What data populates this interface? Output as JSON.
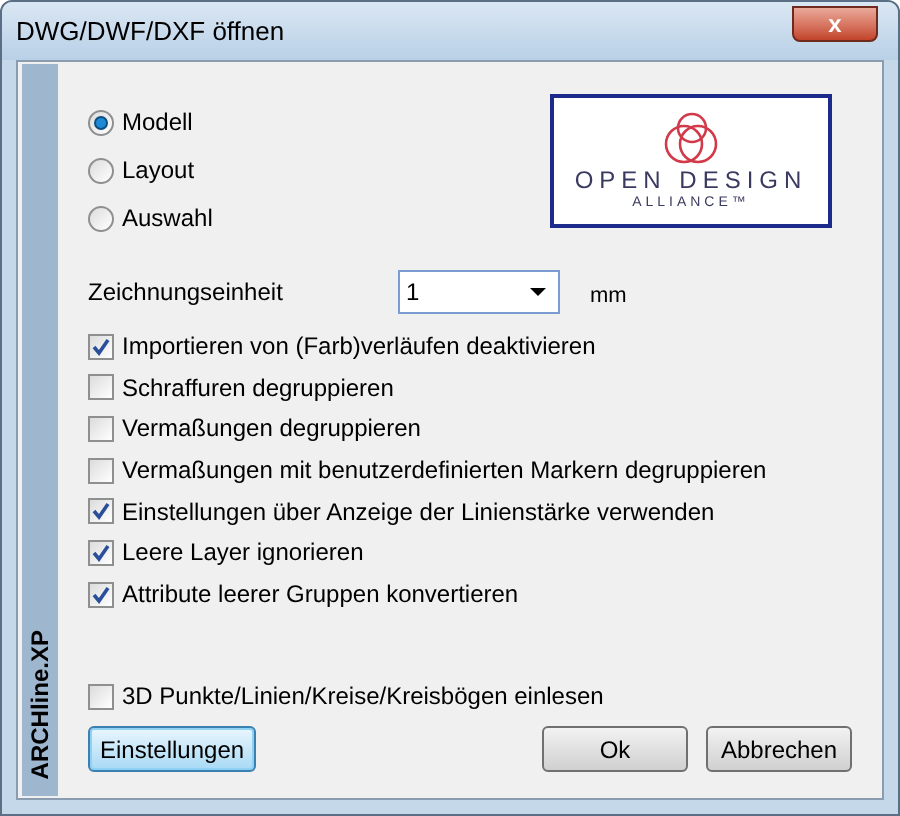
{
  "window": {
    "title": "DWG/DWF/DXF öffnen",
    "close": "x"
  },
  "side_label": "ARCHline.XP",
  "radios": [
    {
      "label": "Modell",
      "selected": true
    },
    {
      "label": "Layout",
      "selected": false
    },
    {
      "label": "Auswahl",
      "selected": false
    }
  ],
  "logo": {
    "line1": "OPEN DESIGN",
    "line2": "ALLIANCE™"
  },
  "unit": {
    "label": "Zeichnungseinheit",
    "value": "1",
    "suffix": "mm"
  },
  "options": [
    {
      "label": "Importieren von (Farb)verläufen deaktivieren",
      "checked": true
    },
    {
      "label": "Schraffuren degruppieren",
      "checked": false
    },
    {
      "label": "Vermaßungen degruppieren",
      "checked": false
    },
    {
      "label": "Vermaßungen mit benutzerdefinierten Markern degruppieren",
      "checked": false
    },
    {
      "label": "Einstellungen über Anzeige der Linienstärke verwenden",
      "checked": true
    },
    {
      "label": "Leere Layer ignorieren",
      "checked": true
    },
    {
      "label": "Attribute leerer Gruppen konvertieren",
      "checked": true
    }
  ],
  "option_3d": {
    "label": "3D Punkte/Linien/Kreise/Kreisbögen einlesen",
    "checked": false
  },
  "buttons": [
    {
      "label": "Einstellungen",
      "kind": "focused"
    },
    {
      "label": "Ok",
      "kind": "normal"
    },
    {
      "label": "Abbrechen",
      "kind": "normal"
    }
  ]
}
